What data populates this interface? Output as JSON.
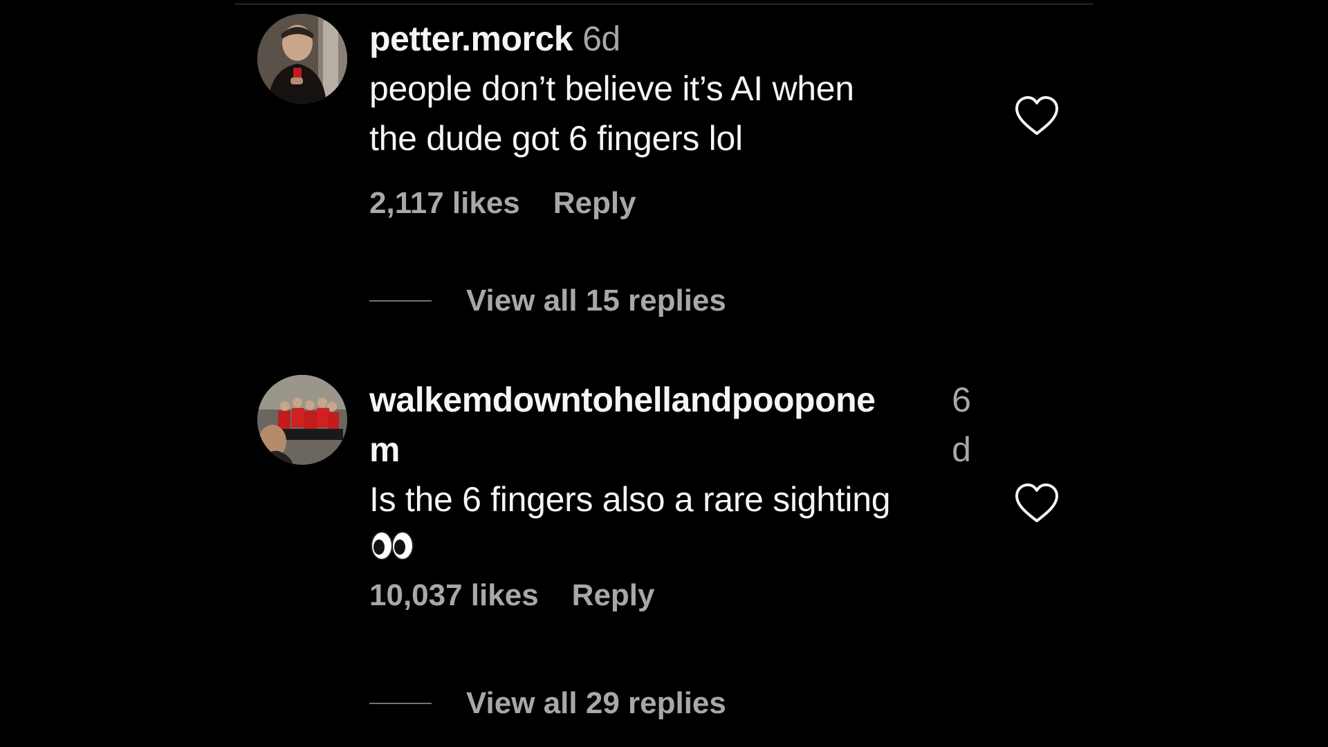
{
  "comments": [
    {
      "username": "petter.morck",
      "time": "6d",
      "text_lines": [
        "people don’t believe it’s AI when",
        "the dude got 6 fingers lol"
      ],
      "likes": "2,117 likes",
      "reply_label": "Reply",
      "view_replies": "View all 15 replies",
      "like_icon": "heart-outline-icon"
    },
    {
      "username_line1": "walkemdowntohellandpoopone",
      "username_line2": "m",
      "time_line1": "6",
      "time_line2": "d",
      "text_line": "Is the 6 fingers also a rare sighting",
      "emoji": "eyes-emoji",
      "likes": "10,037 likes",
      "reply_label": "Reply",
      "view_replies": "View all 29 replies",
      "like_icon": "heart-outline-icon"
    }
  ],
  "colors": {
    "background": "#000000",
    "primary_text": "#f5f5f5",
    "secondary_text": "#a8a8a8",
    "divider": "#262626"
  }
}
